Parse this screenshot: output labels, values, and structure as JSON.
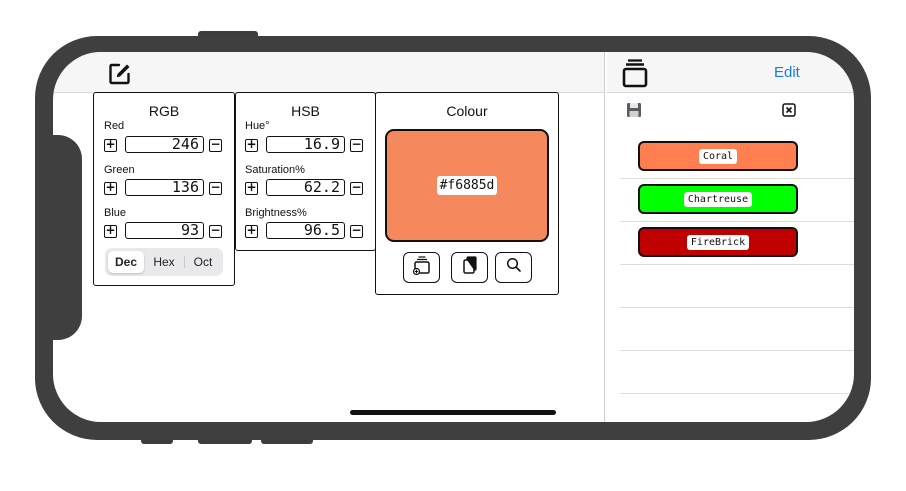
{
  "top_nav": {
    "edit_label": "Edit"
  },
  "rgb": {
    "title": "RGB",
    "fields": [
      {
        "label": "Red",
        "value": "246"
      },
      {
        "label": "Green",
        "value": "136"
      },
      {
        "label": "Blue",
        "value": "93"
      }
    ],
    "modes": [
      "Dec",
      "Hex",
      "Oct"
    ],
    "selected_mode": "Dec"
  },
  "hsb": {
    "title": "HSB",
    "fields": [
      {
        "label": "Hue°",
        "value": "16.9"
      },
      {
        "label": "Saturation%",
        "value": "62.2"
      },
      {
        "label": "Brightness%",
        "value": "96.5"
      }
    ]
  },
  "colour": {
    "title": "Colour",
    "hex": "#f6885d",
    "swatch_color": "#f6885d"
  },
  "saved_colours": [
    {
      "name": "Coral",
      "color": "#ff7f50"
    },
    {
      "name": "Chartreuse",
      "color": "#00ff00"
    },
    {
      "name": "FireBrick",
      "color": "#c00000"
    }
  ],
  "colors": {
    "accent": "#1a7de2",
    "frame": "#3f3f3f"
  }
}
